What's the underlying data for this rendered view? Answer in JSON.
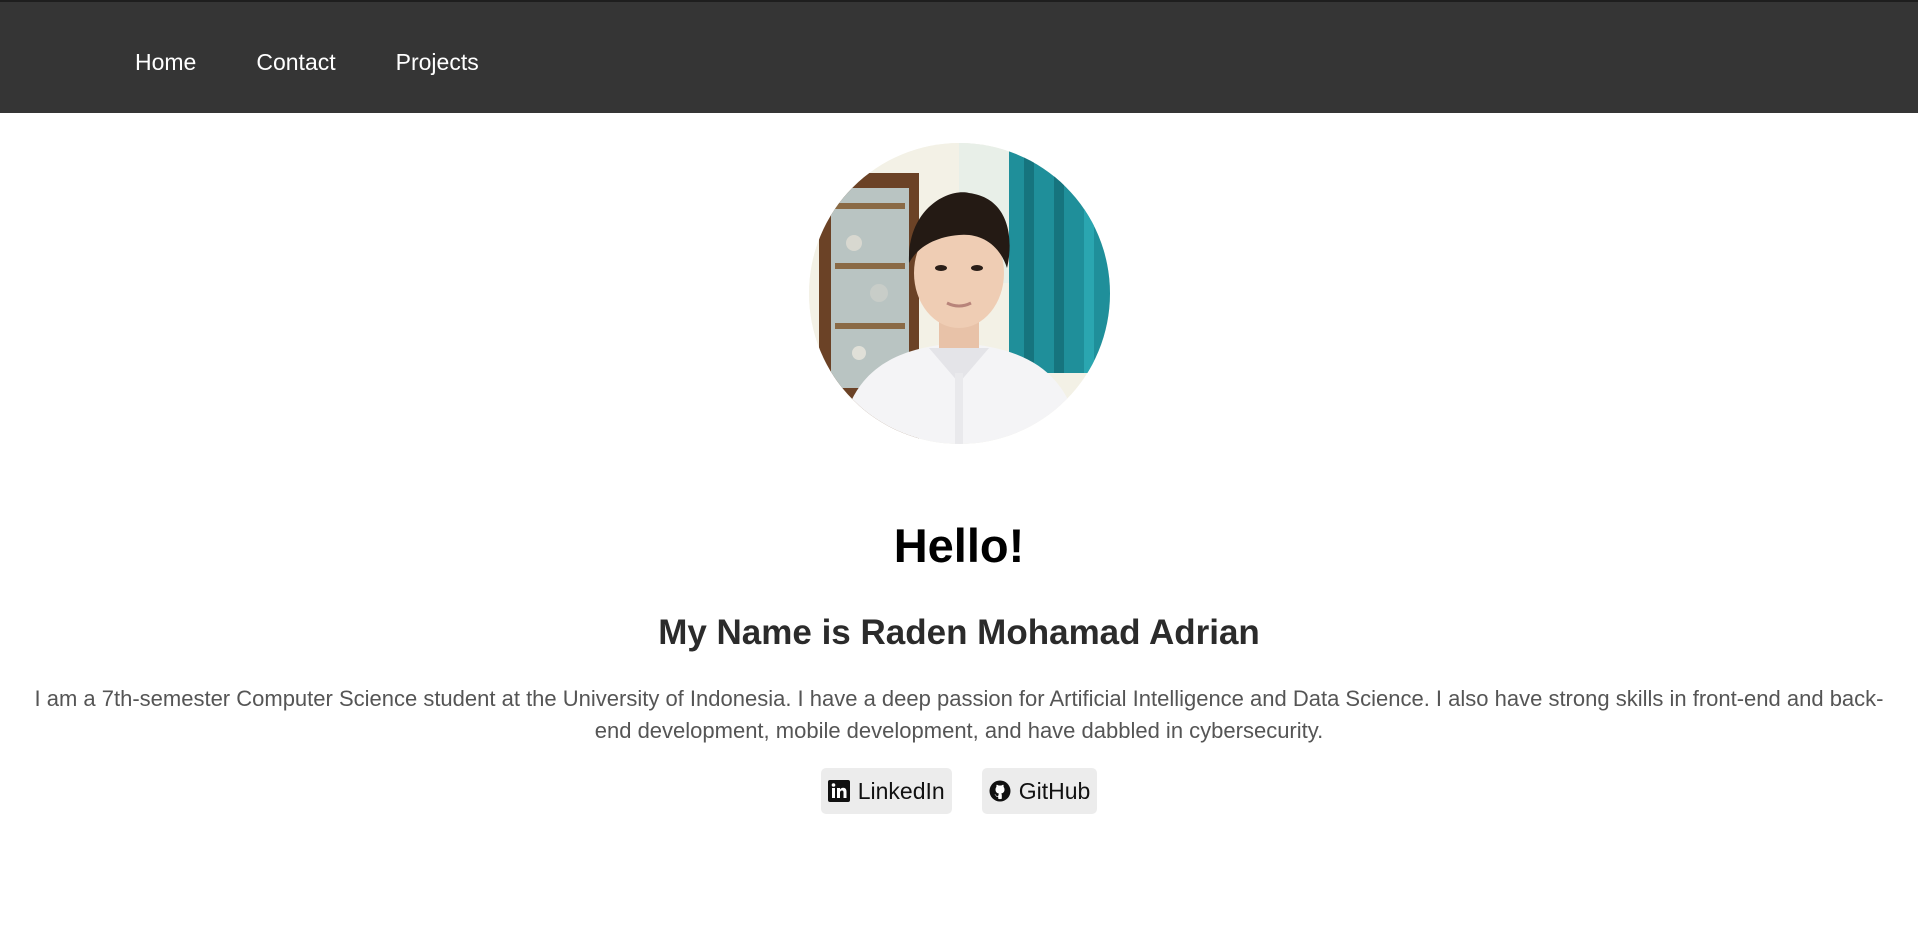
{
  "nav": {
    "items": [
      {
        "label": "Home"
      },
      {
        "label": "Contact"
      },
      {
        "label": "Projects"
      }
    ]
  },
  "hero": {
    "greeting": "Hello!",
    "name_line": "My Name is Raden Mohamad Adrian",
    "bio": "I am a 7th-semester Computer Science student at the University of Indonesia. I have a deep passion for Artificial Intelligence and Data Science. I also have strong skills in front-end and back-end development, mobile development, and have dabbled in cybersecurity.",
    "avatar_icon": "profile-photo"
  },
  "socials": [
    {
      "label": "LinkedIn",
      "icon": "linkedin-icon"
    },
    {
      "label": "GitHub",
      "icon": "github-icon"
    }
  ],
  "colors": {
    "navbar_bg": "#353535",
    "nav_text": "#ffffff",
    "heading": "#000000",
    "subheading": "#2b2b2b",
    "body_text": "#555555",
    "button_bg": "#ececec"
  }
}
